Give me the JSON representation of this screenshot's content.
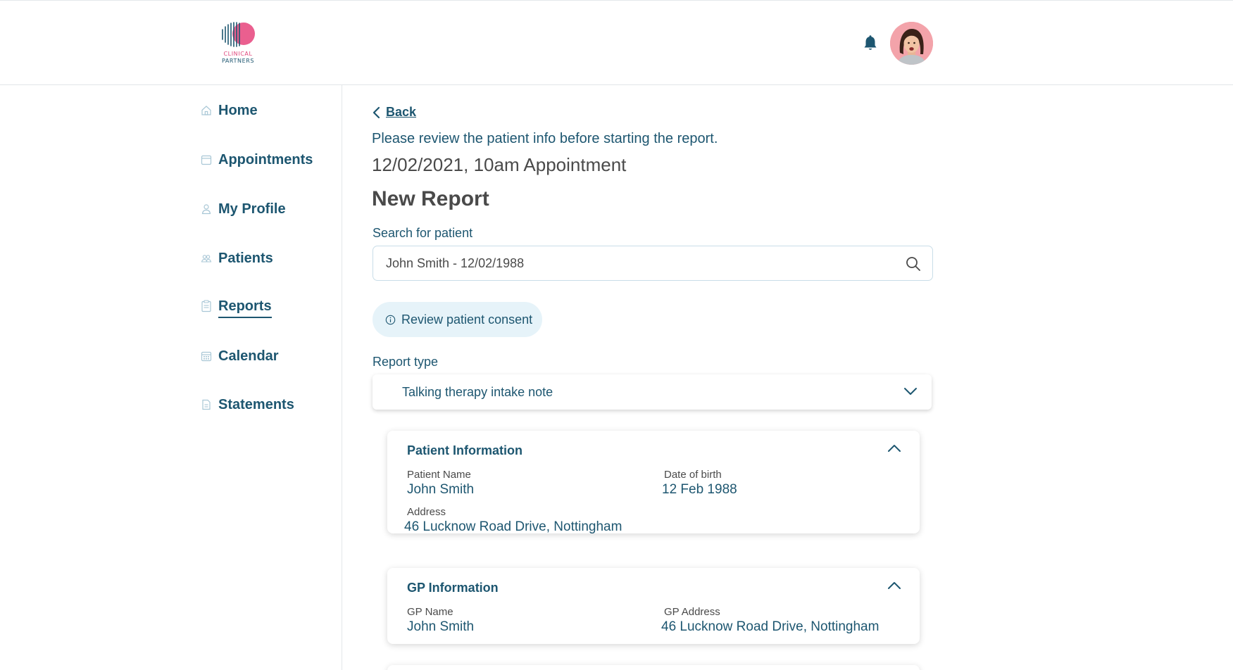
{
  "header": {
    "logo_line1": "CLINICAL",
    "logo_line2": "PARTNERS",
    "notification_icon": "bell-icon",
    "avatar_icon": "user-avatar"
  },
  "sidebar": {
    "items": [
      {
        "label": "Home",
        "icon": "home-icon"
      },
      {
        "label": "Appointments",
        "icon": "calendar-icon"
      },
      {
        "label": "My Profile",
        "icon": "user-icon"
      },
      {
        "label": "Patients",
        "icon": "users-icon"
      },
      {
        "label": "Reports",
        "icon": "clipboard-icon",
        "active": true
      },
      {
        "label": "Calendar",
        "icon": "calendar-grid-icon"
      },
      {
        "label": "Statements",
        "icon": "document-icon"
      }
    ]
  },
  "main": {
    "back_label": "Back",
    "instruction": "Please review the patient info before starting the report.",
    "appointment": "12/02/2021, 10am Appointment",
    "title": "New Report",
    "search": {
      "label": "Search for patient",
      "value": "John Smith - 12/02/1988"
    },
    "consent_label": "Review patient consent",
    "report_type": {
      "label": "Report type",
      "value": "Talking therapy intake note"
    },
    "patient_info": {
      "title": "Patient Information",
      "name_label": "Patient Name",
      "name_value": "John Smith",
      "dob_label": "Date of birth",
      "dob_value": "12 Feb 1988",
      "address_label": "Address",
      "address_value": "46 Lucknow Road Drive, Nottingham"
    },
    "gp_info": {
      "title": "GP Information",
      "name_label": "GP Name",
      "name_value": "John Smith",
      "address_label": "GP Address",
      "address_value": "46 Lucknow Road Drive, Nottingham"
    }
  },
  "colors": {
    "primary": "#1d5670",
    "accent": "#e0457b",
    "muted_text": "#4a4a4a",
    "consent_bg": "#e6f3f9"
  }
}
